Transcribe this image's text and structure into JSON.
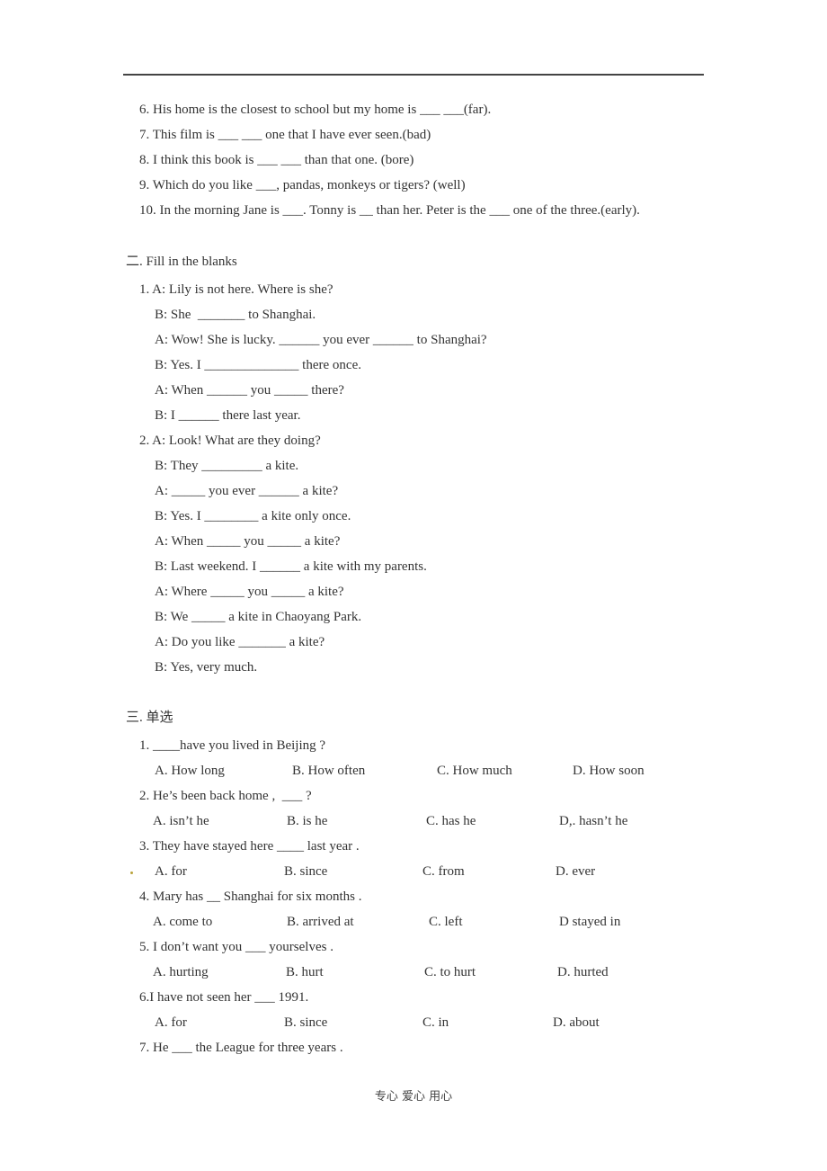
{
  "section1_tail": [
    "6. His home is the closest to school but my home is ___ ___(far).",
    "7. This film is ___ ___ one that I have ever seen.(bad)",
    "8. I think this book is ___ ___ than that one. (bore)",
    "9. Which do you like ___, pandas, monkeys or tigers? (well)",
    "10. In the morning Jane is ___. Tonny is __ than her. Peter is the ___ one of the three.(early)."
  ],
  "section2": {
    "heading": "二. Fill in the blanks",
    "dialogues": [
      {
        "lines": [
          "1. A: Lily is not here. Where is she?",
          "B: She  _______ to Shanghai.",
          "A: Wow! She is lucky. ______ you ever ______ to Shanghai?",
          "B: Yes. I ______________ there once.",
          "A: When ______ you _____ there?",
          "B: I ______ there last year."
        ]
      },
      {
        "lines": [
          "2. A: Look! What are they doing?",
          "B: They _________ a kite.",
          "A: _____ you ever ______ a kite?",
          "B: Yes. I ________ a kite only once.",
          "A: When _____ you _____ a kite?",
          "B: Last weekend. I ______ a kite with my parents.",
          "A: Where _____ you _____ a kite?",
          "B: We _____ a kite in Chaoyang Park.",
          "A: Do you like _______ a kite?",
          "B: Yes, very much."
        ]
      }
    ]
  },
  "section3": {
    "heading": "三. 单选",
    "questions": [
      {
        "q": "1. ____have you lived in Beijing ?",
        "options": [
          "A. How long",
          "B. How often",
          "C. How much",
          "D. How soon"
        ]
      },
      {
        "q": "2. He’s been back home ,  ___ ?",
        "options": [
          "A. isn’t he",
          "B. is he",
          "C. has he",
          "D,. hasn’t he"
        ]
      },
      {
        "q": "3. They have stayed here ____ last year .",
        "options": [
          "A. for",
          "B. since",
          "C. from",
          "D. ever"
        ]
      },
      {
        "q": "4. Mary has __ Shanghai for six months .",
        "options": [
          "A. come to",
          "B. arrived at",
          "C. left",
          "D stayed in"
        ]
      },
      {
        "q": "5. I don’t want you ___ yourselves .",
        "options": [
          "A. hurting",
          "B. hurt",
          "C. to hurt",
          "D. hurted"
        ]
      },
      {
        "q": "6.I have not seen her ___ 1991.",
        "options": [
          "A. for",
          "B. since",
          "C. in",
          "D. about"
        ]
      },
      {
        "q": "7. He ___ the League for three years .",
        "options": []
      }
    ]
  },
  "footer": "专心  爱心  用心"
}
